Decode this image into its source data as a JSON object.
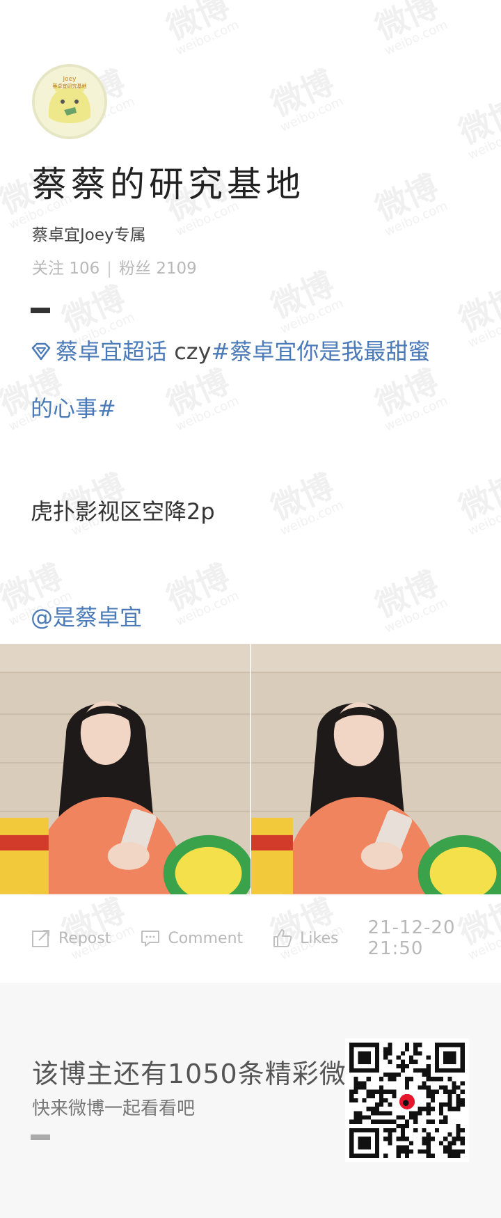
{
  "watermark": {
    "cn": "微博",
    "en": "weibo.com"
  },
  "profile": {
    "avatar_icon": "joey-mascot-avatar",
    "avatar_text_top": "Joey",
    "avatar_text_banner": "蔡卓宜研究基地",
    "title": "蔡蔡的研究基地",
    "subtitle": "蔡卓宜Joey专属",
    "following_label": "关注",
    "following_count": "106",
    "followers_label": "粉丝",
    "followers_count": "2109"
  },
  "post": {
    "topic_icon": "diamond-icon",
    "topic_link": "蔡卓宜超话",
    "topic_plain": " czy",
    "hashtag_part1": "#蔡卓宜你是我最甜蜜",
    "hashtag_part2": "的心事#",
    "text": "虎扑影视区空降2p",
    "mention": "@是蔡卓宜",
    "images": [
      {
        "name": "photo-1",
        "icon": "girl-with-phone-photo"
      },
      {
        "name": "photo-2",
        "icon": "girl-with-phone-photo"
      }
    ]
  },
  "actions": {
    "repost_label": "Repost",
    "comment_label": "Comment",
    "likes_label": "Likes",
    "timestamp": "21-12-20 21:50"
  },
  "footer": {
    "main": "该博主还有1050条精彩微博",
    "sub": "快来微博一起看看吧",
    "qr_icon": "weibo-qr-code"
  },
  "colors": {
    "link": "#4a7ab8",
    "muted": "#b8b8b8",
    "footer_bg": "#f7f7f7"
  }
}
